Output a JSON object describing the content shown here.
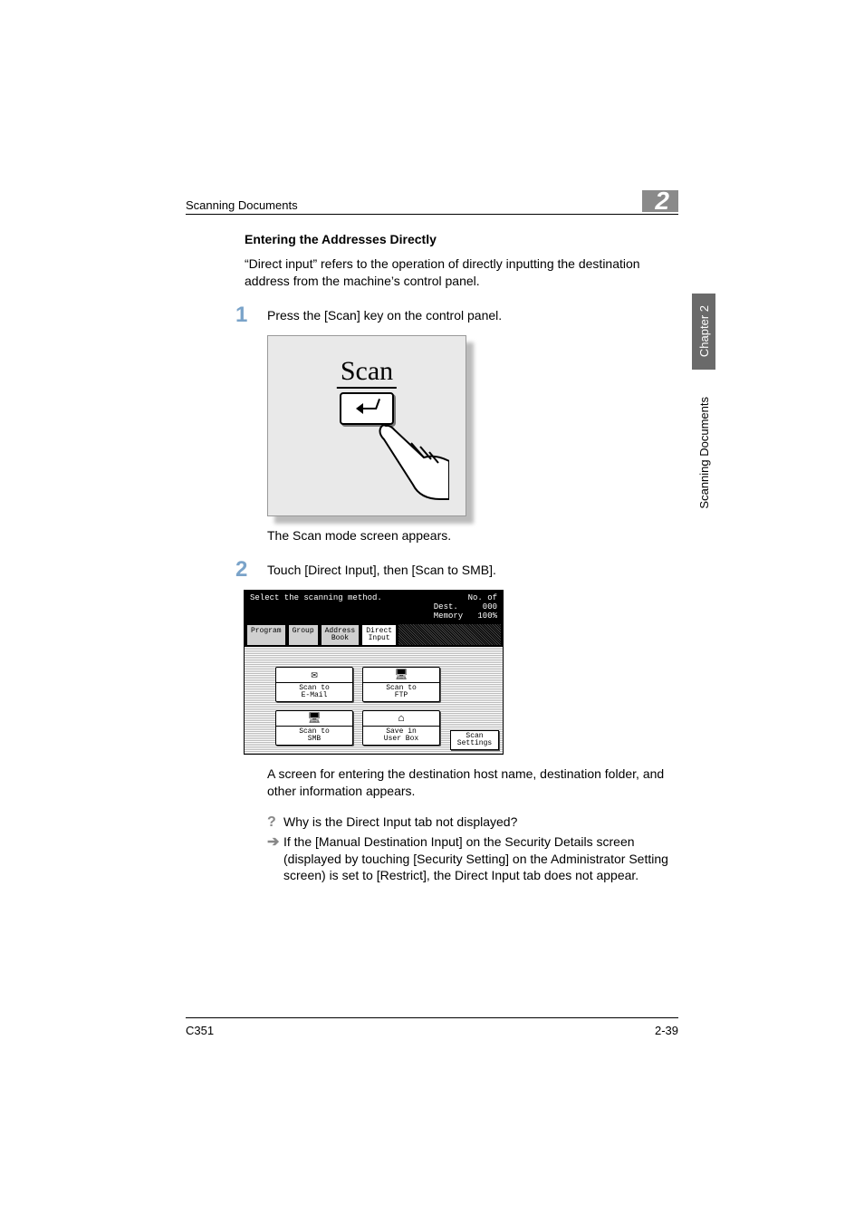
{
  "header": {
    "title": "Scanning Documents",
    "chapter_badge": "2"
  },
  "side": {
    "tab": "Chapter 2",
    "label": "Scanning Documents"
  },
  "section_title": "Entering the Addresses Directly",
  "intro": "“Direct input” refers to the operation of directly inputting the destination address from the machine’s control panel.",
  "steps": {
    "s1_num": "1",
    "s1_text": "Press the [Scan] key on the control panel.",
    "s1_after": "The Scan mode screen appears.",
    "s2_num": "2",
    "s2_text": "Touch [Direct Input], then [Scan to SMB].",
    "s2_after": "A screen for entering the destination host name, destination folder, and other information appears."
  },
  "qa": {
    "q": "Why is the Direct Input tab not displayed?",
    "a": "If the [Manual Destination Input] on the Security Details screen (displayed by touching [Security Setting] on the Administrator Setting screen) is set to [Restrict], the Direct Input tab does not appear."
  },
  "fig1": {
    "label": "Scan"
  },
  "fig2": {
    "prompt": "Select the scanning method.",
    "status": "No. of\nDest.     000\nMemory   100%",
    "tabs": {
      "program": "Program",
      "group": "Group",
      "address_book": "Address\nBook",
      "direct_input": "Direct\nInput"
    },
    "buttons": {
      "email": "Scan to\nE-Mail",
      "ftp": "Scan to\nFTP",
      "smb": "Scan to\nSMB",
      "userbox": "Save in\nUser Box",
      "scan_settings": "Scan\nSettings"
    }
  },
  "footer": {
    "left": "C351",
    "right": "2-39"
  }
}
